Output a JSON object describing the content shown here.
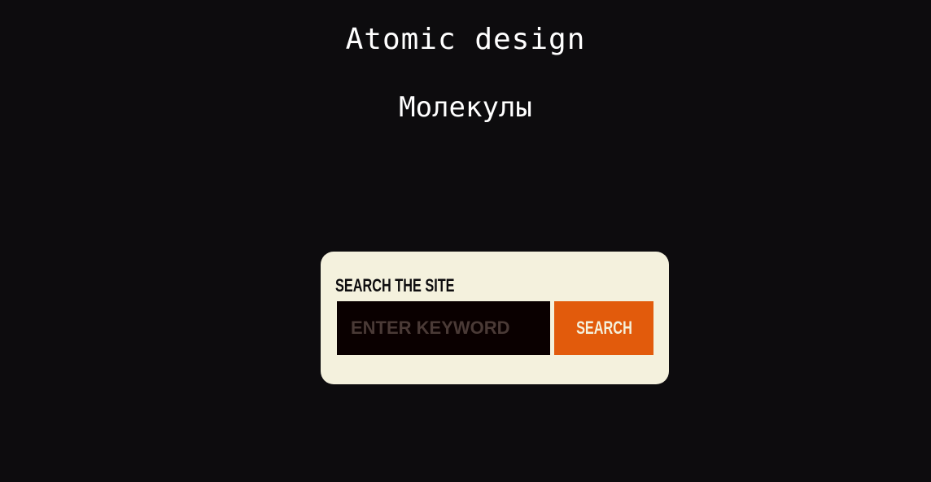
{
  "header": {
    "title": "Atomic design",
    "subtitle": "Молекулы"
  },
  "search_form": {
    "label": "SEARCH THE SITE",
    "input_placeholder": "ENTER KEYWORD",
    "input_value": "",
    "button_label": "SEARCH"
  },
  "colors": {
    "background": "#0d0c0e",
    "card_background": "#f4f1dd",
    "input_background": "#0a0000",
    "placeholder_text": "#4a3a36",
    "button_accent": "#e25b0c",
    "button_text": "#f4f1dd",
    "heading_text": "#ffffff"
  }
}
